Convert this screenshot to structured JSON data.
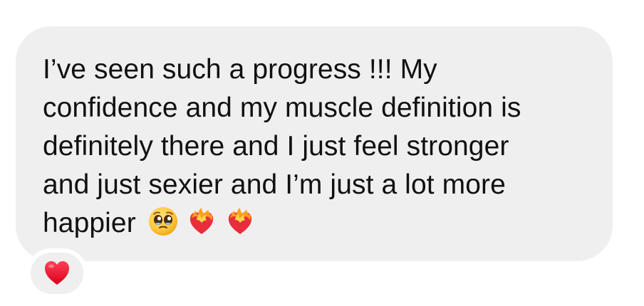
{
  "message": {
    "lines": [
      "I’ve seen such a progress !!! My",
      "confidence and my muscle definition is",
      "definitely there and I just feel stronger",
      "and just sexier and I’m just a lot more",
      "happier"
    ],
    "emojis": [
      "pleading-face-icon",
      "heart-on-fire-icon",
      "heart-on-fire-icon"
    ]
  },
  "reaction": {
    "emoji": "red-heart-icon"
  },
  "colors": {
    "bubble": "#efefef",
    "text": "#111111",
    "heart": "#e21b2d"
  }
}
